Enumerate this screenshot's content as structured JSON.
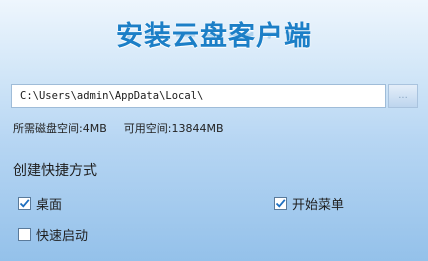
{
  "header": {
    "title": "安装云盘客户端"
  },
  "install": {
    "path_value": "C:\\Users\\admin\\AppData\\Local\\",
    "browse_label": "..."
  },
  "space": {
    "required_label": "所需磁盘空间:",
    "required_value": "4MB",
    "available_label": "可用空间:",
    "available_value": "13844MB"
  },
  "shortcuts": {
    "section_title": "创建快捷方式",
    "items": [
      {
        "label": "桌面",
        "checked": true
      },
      {
        "label": "开始菜单",
        "checked": true
      },
      {
        "label": "快速启动",
        "checked": false
      }
    ]
  },
  "colors": {
    "accent": "#1c7fc7",
    "background_top": "#eef6fd",
    "background_bottom": "#94c1ea"
  }
}
